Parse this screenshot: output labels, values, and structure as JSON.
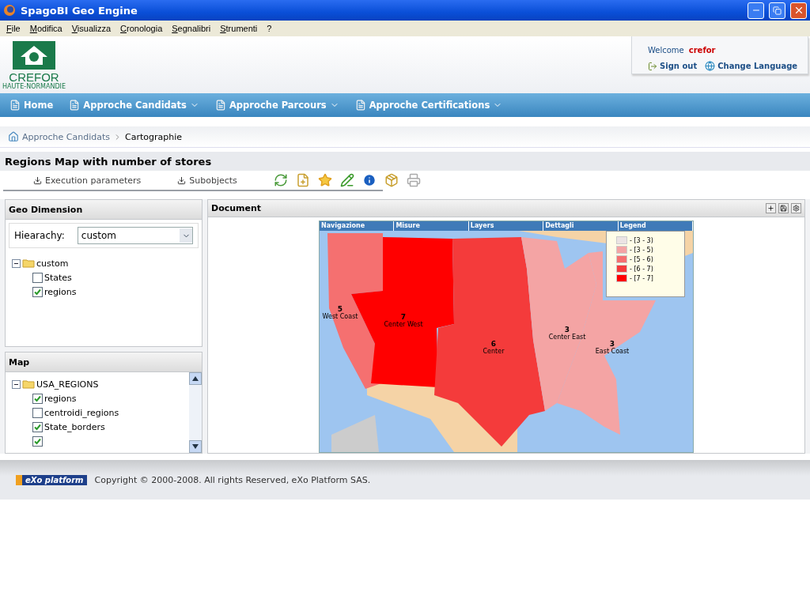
{
  "window": {
    "title": "SpagoBI Geo Engine"
  },
  "menu": [
    "File",
    "Modifica",
    "Visualizza",
    "Cronologia",
    "Segnalibri",
    "Strumenti",
    "?"
  ],
  "logo": {
    "name": "CREFOR",
    "subtitle": "HAUTE-NORMANDIE"
  },
  "user_box": {
    "welcome": "Welcome",
    "user": "crefor",
    "sign_out": "Sign out",
    "change_language": "Change Language"
  },
  "nav": [
    {
      "label": "Home",
      "dropdown": false
    },
    {
      "label": "Approche Candidats",
      "dropdown": true
    },
    {
      "label": "Approche Parcours",
      "dropdown": true
    },
    {
      "label": "Approche Certifications",
      "dropdown": true
    }
  ],
  "breadcrumb": [
    {
      "label": "Approche Candidats",
      "current": false
    },
    {
      "label": "Cartographie",
      "current": true
    }
  ],
  "page_title": "Regions Map with number of stores",
  "toolbar": {
    "tabs": [
      "Execution parameters",
      "Subobjects"
    ]
  },
  "geo_panel": {
    "title": "Geo Dimension",
    "hierarchy_label": "Hiearachy:",
    "hierarchy_value": "custom",
    "tree": [
      {
        "label": "custom",
        "expanded": true,
        "children": [
          {
            "label": "States",
            "checked": false
          },
          {
            "label": "regions",
            "checked": true
          }
        ]
      }
    ]
  },
  "map_panel": {
    "title": "Map",
    "tree": [
      {
        "label": "USA_REGIONS",
        "expanded": true,
        "children": [
          {
            "label": "regions",
            "checked": true
          },
          {
            "label": "centroidi_regions",
            "checked": false
          },
          {
            "label": "State_borders",
            "checked": true
          },
          {
            "checked": true
          }
        ]
      }
    ]
  },
  "document": {
    "title": "Document",
    "map_tabs": [
      "Navigazione",
      "Misure",
      "Layers",
      "Dettagli",
      "Legend"
    ],
    "legend": [
      {
        "label": "- [3 - 3)",
        "color": "#ece4e4"
      },
      {
        "label": "- [3 - 5)",
        "color": "#f4a4a4"
      },
      {
        "label": "- [5 - 6)",
        "color": "#f57070"
      },
      {
        "label": "- [6 - 7)",
        "color": "#f43b3b"
      },
      {
        "label": "- [7 - 7]",
        "color": "#ff0000"
      }
    ],
    "regions": [
      {
        "value": "5",
        "name": "West Coast",
        "color": "#f57070"
      },
      {
        "value": "7",
        "name": "Center West",
        "color": "#ff0000"
      },
      {
        "value": "6",
        "name": "Center",
        "color": "#f43b3b"
      },
      {
        "value": "3",
        "name": "Center East",
        "color": "#f4a4a4"
      },
      {
        "value": "3",
        "name": "East Coast",
        "color": "#f4a4a4"
      }
    ]
  },
  "footer": {
    "logo": "eXo platform",
    "copyright": "Copyright © 2000-2008. All rights Reserved, eXo Platform SAS."
  }
}
